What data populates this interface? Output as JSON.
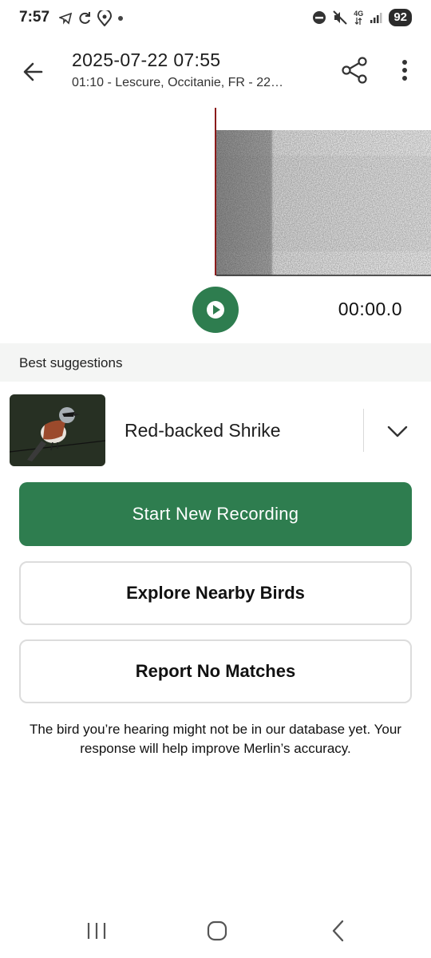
{
  "status_bar": {
    "time": "7:57",
    "network": "4G",
    "battery": "92",
    "left_icons": [
      "telegram-icon",
      "sync-icon",
      "location-pet-icon",
      "dot-icon"
    ],
    "right_icons": [
      "do-not-disturb-icon",
      "mute-icon",
      "network-icon",
      "signal-icon",
      "battery-icon"
    ]
  },
  "header": {
    "title": "2025-07-22 07:55",
    "subtitle": "01:10 - Lescure, Occitanie, FR - 22…"
  },
  "player": {
    "time": "00:00.0"
  },
  "suggestions": {
    "section_title": "Best suggestions",
    "items": [
      {
        "name": "Red-backed Shrike"
      }
    ]
  },
  "actions": {
    "start_new_recording": "Start New Recording",
    "explore_nearby_birds": "Explore Nearby Birds",
    "report_no_matches": "Report No Matches"
  },
  "footnote": "The bird you’re hearing might not be in our database yet. Your response will help improve Merlin’s accuracy.",
  "colors": {
    "brand_green": "#2e7d4f",
    "section_bg": "#f4f5f4",
    "spectrogram_cursor": "#8b1a1a"
  }
}
